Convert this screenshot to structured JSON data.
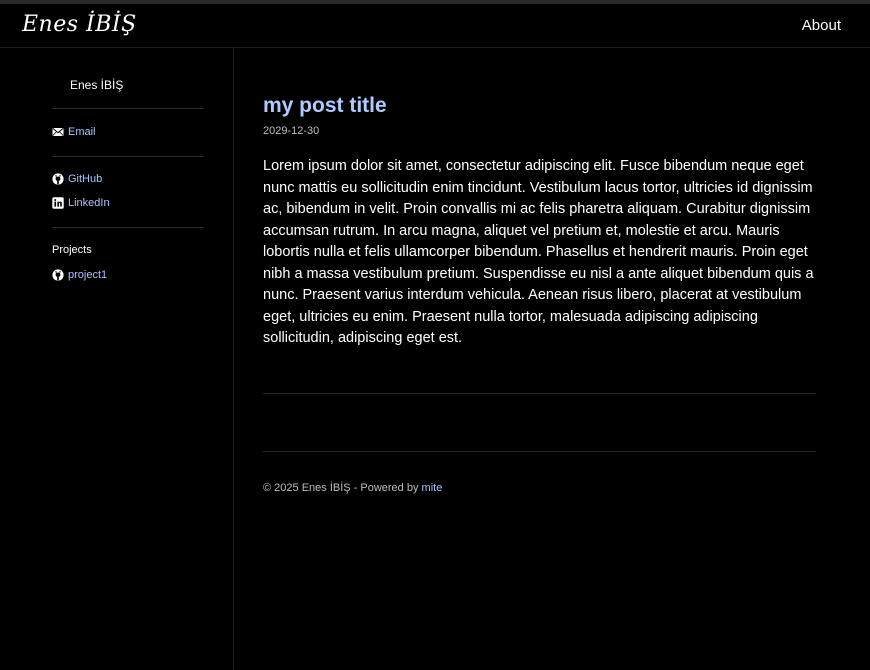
{
  "header": {
    "brand": "Enes İBİŞ",
    "nav_about": "About"
  },
  "sidebar": {
    "name": "Enes İBİŞ",
    "email_label": "Email",
    "github_label": "GitHub",
    "linkedin_label": "LinkedIn",
    "projects_heading": "Projects",
    "project1_label": "project1"
  },
  "post": {
    "title": "my post title",
    "date": "2029-12-30",
    "body": "Lorem ipsum dolor sit amet, consectetur adipiscing elit. Fusce bibendum neque eget nunc mattis eu sollicitudin enim tincidunt. Vestibulum lacus tortor, ultricies id dignissim ac, bibendum in velit. Proin convallis mi ac felis pharetra aliquam. Curabitur dignissim accumsan rutrum. In arcu magna, aliquet vel pretium et, mo­lestie et arcu. Mauris lobortis nulla et felis ullamcorper bibendum. Phasellus et hendrerit mauris. Proin eget nibh a massa vestibulum pretium. Suspendisse eu nisl a ante aliquet bibendum quis a nunc. Praesent varius interdum vehicula. Aenean risus libero, placerat at vestibulum eget, ultricies eu enim. Praesent nulla tortor, malesuada adipiscing adipiscing sollicitudin, adipiscing eget est."
  },
  "footer": {
    "copyright": "© 2025 Enes İBİŞ - Powered by",
    "powered_link": "mite"
  },
  "colors": {
    "background": "#000000",
    "accent_title": "#aecbff",
    "link": "#a8c4ff",
    "muted_text": "#bdbdbd"
  },
  "icons": {
    "email": "envelope-icon",
    "github": "github-icon",
    "linkedin": "linkedin-icon",
    "project": "github-icon"
  }
}
